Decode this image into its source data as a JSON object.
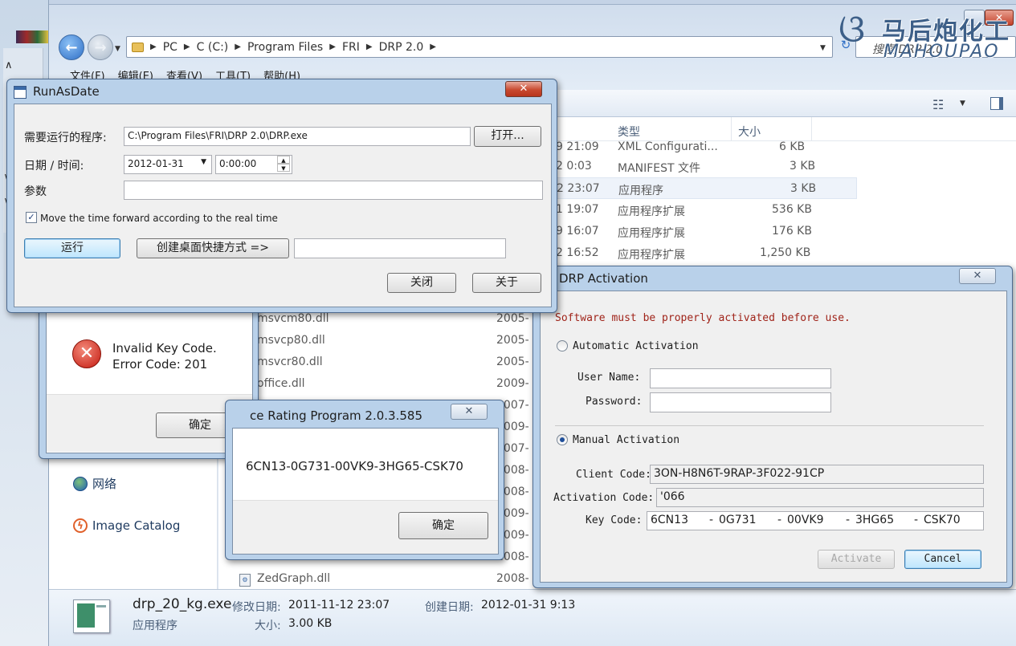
{
  "explorer": {
    "breadcrumbs": [
      "PC",
      "C (C:)",
      "Program Files",
      "FRI",
      "DRP 2.0"
    ],
    "search_placeholder": "搜索 DRP 2.0",
    "menu": [
      "文件(F)",
      "编辑(E)",
      "查看(V)",
      "工具(T)",
      "帮助(H)"
    ],
    "columns": {
      "type": "类型",
      "size": "大小"
    },
    "rows_top": [
      {
        "date": "9 21:09",
        "type": "XML Configurati...",
        "size": "6 KB"
      },
      {
        "date": "2 0:03",
        "type": "MANIFEST 文件",
        "size": "3 KB"
      },
      {
        "date": "2 23:07",
        "type": "应用程序",
        "size": "3 KB"
      },
      {
        "date": "1 19:07",
        "type": "应用程序扩展",
        "size": "536 KB"
      },
      {
        "date": "9 16:07",
        "type": "应用程序扩展",
        "size": "176 KB"
      },
      {
        "date": "2 16:52",
        "type": "应用程序扩展",
        "size": "1,250 KB"
      }
    ],
    "rows_bottom": [
      {
        "name": "msvcm80.dll",
        "date": "2005-"
      },
      {
        "name": "msvcp80.dll",
        "date": "2005-"
      },
      {
        "name": "msvcr80.dll",
        "date": "2005-"
      },
      {
        "name": "office.dll",
        "date": "2009-"
      },
      {
        "name": "",
        "date": "2007-"
      },
      {
        "name": "",
        "date": "2009-"
      },
      {
        "name": "",
        "date": "2007-"
      },
      {
        "name": "",
        "date": "2008-"
      },
      {
        "name": "",
        "date": "2008-"
      },
      {
        "name": "",
        "date": "2009-"
      },
      {
        "name": "",
        "date": "2009-"
      },
      {
        "name": "",
        "date": "2008-"
      },
      {
        "name": "ZedGraph.dll",
        "date": "2008-"
      }
    ],
    "nav": {
      "network": "网络",
      "image_catalog": "Image Catalog"
    },
    "details": {
      "filename": "drp_20_kg.exe",
      "filetype": "应用程序",
      "modified_label": "修改日期:",
      "modified_value": "2011-11-12 23:07",
      "created_label": "创建日期:",
      "created_value": "2012-01-31 9:13",
      "size_label": "大小:",
      "size_value": "3.00 KB"
    }
  },
  "watermark": {
    "cn": "马后炮化工",
    "en": "MAHOUPAO"
  },
  "runasdate": {
    "title": "RunAsDate",
    "program_label": "需要运行的程序:",
    "program_value": "C:\\Program Files\\FRI\\DRP 2.0\\DRP.exe",
    "open_button": "打开...",
    "datetime_label": "日期 / 时间:",
    "date_value": "2012-01-31",
    "time_value": "0:00:00",
    "params_label": "参数",
    "params_value": "",
    "checkbox_label": "Move the time forward according to the real time",
    "checkbox_checked": true,
    "run_button": "运行",
    "shortcut_button": "创建桌面快捷方式 =>",
    "shortcut_value": "",
    "close_button": "关闭",
    "about_button": "关于"
  },
  "drp": {
    "title": "DRP Activation",
    "warning": "Software must be properly activated before use.",
    "auto_label": "Automatic Activation",
    "user_label": "User Name:",
    "password_label": "Password:",
    "manual_label": "Manual Activation",
    "client_code_label": "Client Code:",
    "client_code_value": "3ON-H8N6T-9RAP-3F022-91CP",
    "activation_code_label": "Activation Code:",
    "activation_code_value": "'066",
    "key_code_label": "Key Code:",
    "key_segments": [
      "6CN13",
      "0G731",
      "00VK9",
      "3HG65",
      "CSK70"
    ],
    "activate_button": "Activate",
    "cancel_button": "Cancel"
  },
  "error": {
    "line1": "Invalid Key Code.",
    "line2": "Error Code: 201",
    "ok_button": "确定"
  },
  "keydlg": {
    "title": "ce Rating Program 2.0.3.585",
    "key": "6CN13-0G731-00VK9-3HG65-CSK70",
    "ok_button": "确定"
  }
}
